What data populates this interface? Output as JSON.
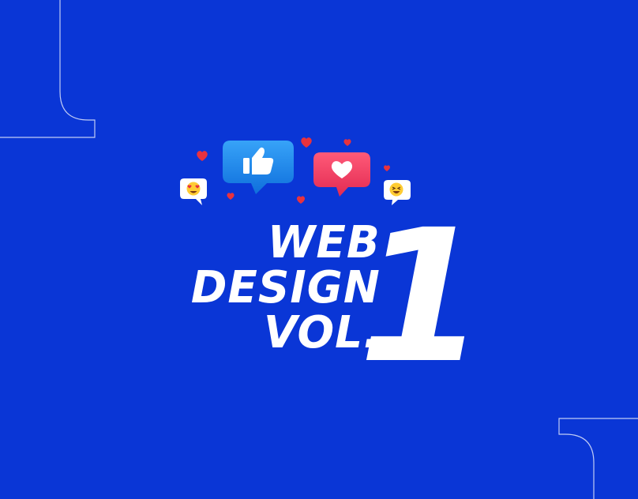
{
  "title": {
    "line1": "WEB",
    "line2": "DESIGN",
    "line3": "VOL.",
    "number": "1"
  },
  "colors": {
    "background": "#0a36d6",
    "text": "#ffffff",
    "like_bubble": "#1e90ff",
    "heart_bubble": "#f0365a",
    "heart": "#e8323e",
    "emoji_bubble": "#ffffff"
  },
  "icons": {
    "like": "thumbs-up-icon",
    "love": "heart-icon",
    "emoji_love": "heart-eyes-emoji-icon",
    "emoji_laugh": "laughing-emoji-icon",
    "small_heart": "small-heart-icon"
  }
}
